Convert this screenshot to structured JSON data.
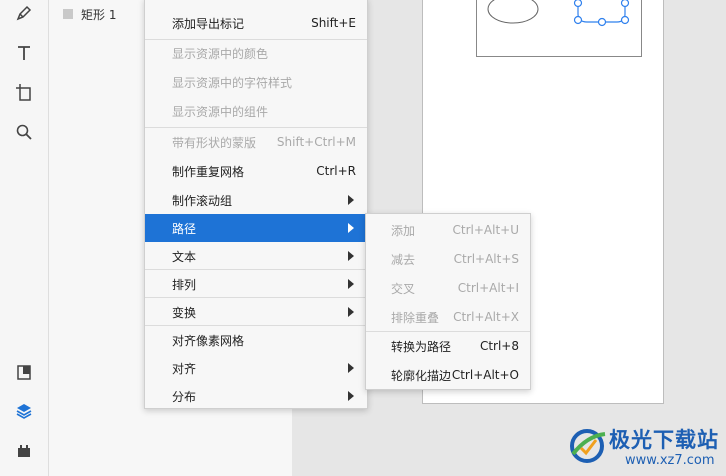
{
  "layers": {
    "item": "矩形 1"
  },
  "context_menu": {
    "items": [
      {
        "label": "添加导出标记",
        "shortcut": "Shift+E"
      },
      {
        "label": "显示资源中的颜色",
        "shortcut": ""
      },
      {
        "label": "显示资源中的字符样式",
        "shortcut": ""
      },
      {
        "label": "显示资源中的组件",
        "shortcut": ""
      },
      {
        "label": "带有形状的蒙版",
        "shortcut": "Shift+Ctrl+M"
      },
      {
        "label": "制作重复网格",
        "shortcut": "Ctrl+R"
      },
      {
        "label": "制作滚动组",
        "shortcut": ""
      },
      {
        "label": "路径",
        "shortcut": ""
      },
      {
        "label": "文本",
        "shortcut": ""
      },
      {
        "label": "排列",
        "shortcut": ""
      },
      {
        "label": "变换",
        "shortcut": ""
      },
      {
        "label": "对齐像素网格",
        "shortcut": ""
      },
      {
        "label": "对齐",
        "shortcut": ""
      },
      {
        "label": "分布",
        "shortcut": ""
      }
    ]
  },
  "submenu": {
    "items": [
      {
        "label": "添加",
        "shortcut": "Ctrl+Alt+U"
      },
      {
        "label": "减去",
        "shortcut": "Ctrl+Alt+S"
      },
      {
        "label": "交叉",
        "shortcut": "Ctrl+Alt+I"
      },
      {
        "label": "排除重叠",
        "shortcut": "Ctrl+Alt+X"
      },
      {
        "label": "转换为路径",
        "shortcut": "Ctrl+8"
      },
      {
        "label": "轮廓化描边",
        "shortcut": "Ctrl+Alt+O"
      }
    ]
  },
  "watermark": {
    "title": "极光下载站",
    "url": "www.xz7.com"
  },
  "colors": {
    "highlight": "#1e73d6",
    "selection": "#2f80ed",
    "watermark": "#1d5fb3"
  }
}
